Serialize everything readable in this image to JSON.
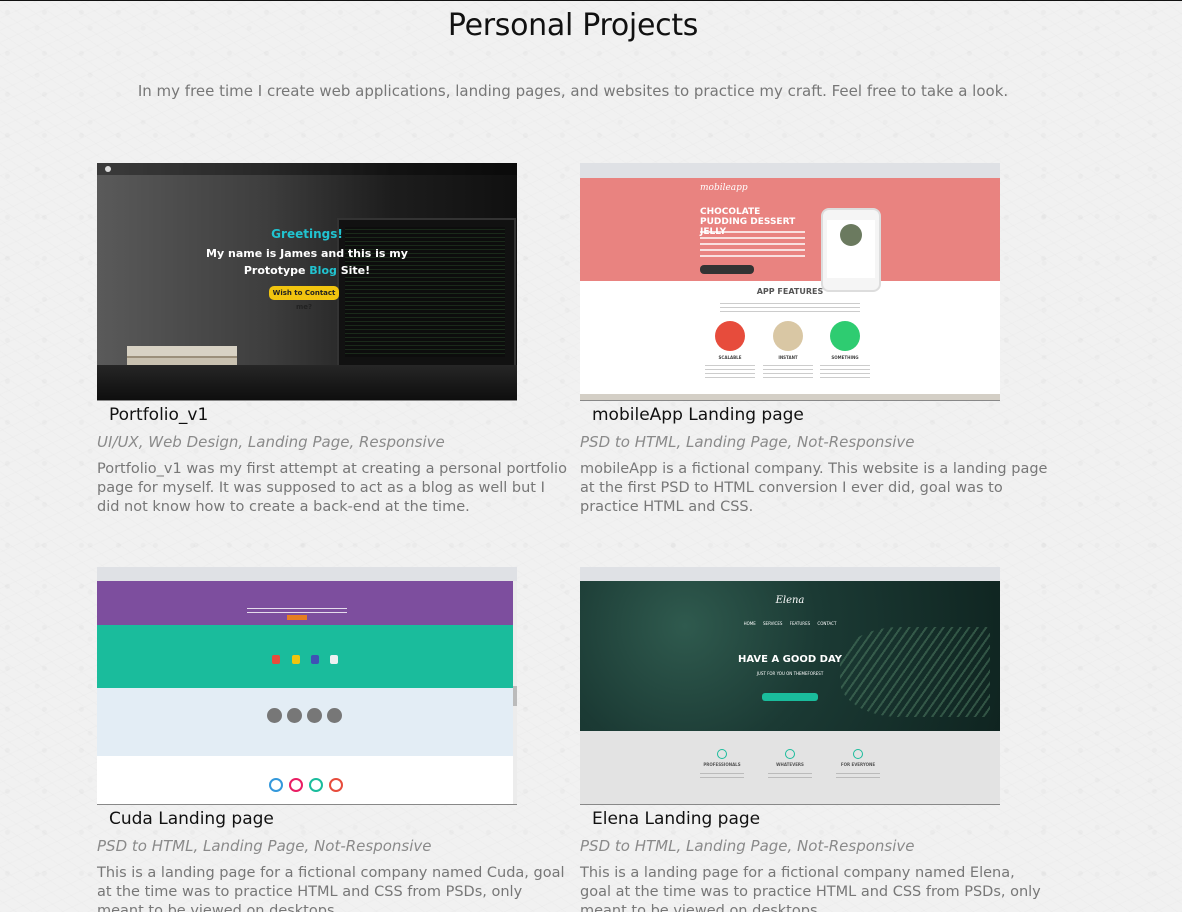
{
  "page": {
    "title": "Personal Projects",
    "subtitle": "In my free time I create web applications, landing pages, and websites to practice my craft. Feel free to take a look."
  },
  "projects": [
    {
      "name": "Portfolio_v1",
      "tags": "UI/UX, Web Design, Landing Page, Responsive",
      "description": "Portfolio_v1 was my first attempt at creating a personal portfolio page for myself. It was supposed to act as a blog as well but I did not know how to create a back-end at the time.",
      "preview": {
        "greeting": "Greetings!",
        "intro_line1": "My name is James and this is my",
        "intro_line2_pre": "Prototype ",
        "intro_line2_hl": "Blog",
        "intro_line2_post": " Site!",
        "cta": "Wish to Contact me?"
      }
    },
    {
      "name": "mobileApp Landing page",
      "tags": "PSD to HTML, Landing Page, Not-Responsive",
      "description": "mobileApp is a fictional company. This website is a landing page at the first PSD to HTML conversion I ever did, goal was to practice HTML and CSS.",
      "preview": {
        "logo": "mobileapp",
        "headline": "CHOCOLATE PUDDING DESSERT JELLY",
        "features_title": "APP FEATURES",
        "feature_labels": [
          "SCALABLE",
          "INSTANT",
          "SOMETHING"
        ]
      }
    },
    {
      "name": "Cuda Landing page",
      "tags": "PSD to HTML, Landing Page, Not-Responsive",
      "description": "This is a landing page for a fictional company named Cuda, goal at the time was to practice HTML and CSS from PSDs, only meant to be viewed on desktops."
    },
    {
      "name": "Elena Landing page",
      "tags": "PSD to HTML, Landing Page, Not-Responsive",
      "description": "This is a landing page for a fictional company named Elena, goal at the time was to practice HTML and CSS from PSDs, only meant to be viewed on desktops.",
      "preview": {
        "logo": "Elena",
        "nav": "HOME SERVICES FEATURES CONTACT",
        "headline": "HAVE A GOOD DAY",
        "sub": "JUST FOR YOU ON THEMEFOREST",
        "service_labels": [
          "PROFESSIONALS",
          "WHATEVERS",
          "FOR EVERYONE"
        ]
      }
    }
  ],
  "colors": {
    "accent_cyan": "#21c3d0",
    "mobileapp_pink": "#e98380",
    "cuda_purple": "#7d4e9e",
    "cuda_teal": "#1abc9c"
  }
}
